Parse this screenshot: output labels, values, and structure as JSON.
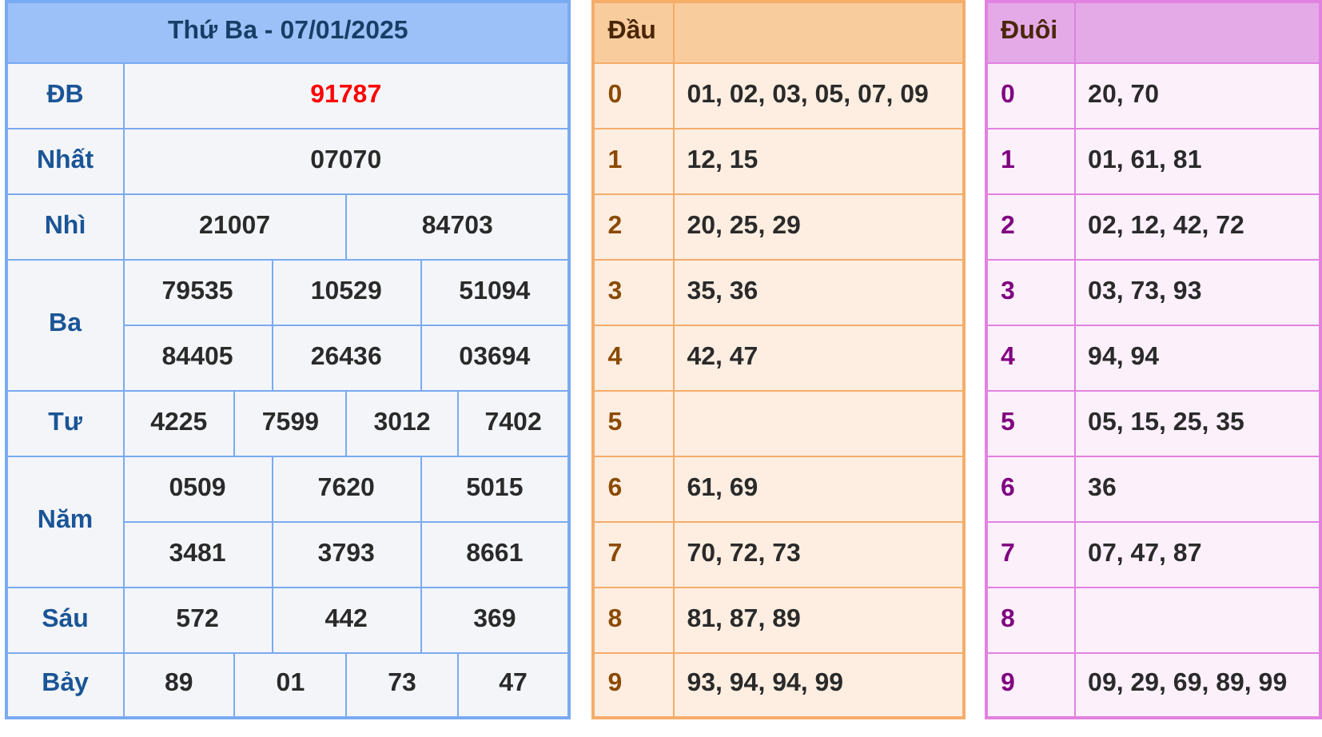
{
  "results": {
    "title": "Thứ Ba - 07/01/2025",
    "prizes": [
      {
        "name": "ĐB",
        "kind": "special",
        "lines": [
          [
            "91787"
          ]
        ]
      },
      {
        "name": "Nhất",
        "kind": "normal",
        "lines": [
          [
            "07070"
          ]
        ]
      },
      {
        "name": "Nhì",
        "kind": "normal",
        "lines": [
          [
            "21007",
            "84703"
          ]
        ]
      },
      {
        "name": "Ba",
        "kind": "normal",
        "lines": [
          [
            "79535",
            "10529",
            "51094"
          ],
          [
            "84405",
            "26436",
            "03694"
          ]
        ]
      },
      {
        "name": "Tư",
        "kind": "normal",
        "lines": [
          [
            "4225",
            "7599",
            "3012",
            "7402"
          ]
        ]
      },
      {
        "name": "Năm",
        "kind": "normal",
        "lines": [
          [
            "0509",
            "7620",
            "5015"
          ],
          [
            "3481",
            "3793",
            "8661"
          ]
        ]
      },
      {
        "name": "Sáu",
        "kind": "normal",
        "lines": [
          [
            "572",
            "442",
            "369"
          ]
        ]
      },
      {
        "name": "Bảy",
        "kind": "normal",
        "lines": [
          [
            "89",
            "01",
            "73",
            "47"
          ]
        ]
      }
    ]
  },
  "head_table": {
    "title": "Đầu",
    "rows": [
      {
        "digit": "0",
        "numbers": "01, 02, 03, 05, 07, 09"
      },
      {
        "digit": "1",
        "numbers": "12, 15"
      },
      {
        "digit": "2",
        "numbers": "20, 25, 29"
      },
      {
        "digit": "3",
        "numbers": "35, 36"
      },
      {
        "digit": "4",
        "numbers": "42, 47"
      },
      {
        "digit": "5",
        "numbers": ""
      },
      {
        "digit": "6",
        "numbers": "61, 69"
      },
      {
        "digit": "7",
        "numbers": "70, 72, 73"
      },
      {
        "digit": "8",
        "numbers": "81, 87, 89"
      },
      {
        "digit": "9",
        "numbers": "93, 94, 94, 99"
      }
    ]
  },
  "tail_table": {
    "title": "Đuôi",
    "rows": [
      {
        "digit": "0",
        "numbers": "20, 70"
      },
      {
        "digit": "1",
        "numbers": "01, 61, 81"
      },
      {
        "digit": "2",
        "numbers": "02, 12, 42, 72"
      },
      {
        "digit": "3",
        "numbers": "03, 73, 93"
      },
      {
        "digit": "4",
        "numbers": "94, 94"
      },
      {
        "digit": "5",
        "numbers": "05, 15, 25, 35"
      },
      {
        "digit": "6",
        "numbers": "36"
      },
      {
        "digit": "7",
        "numbers": "07, 47, 87"
      },
      {
        "digit": "8",
        "numbers": ""
      },
      {
        "digit": "9",
        "numbers": "09, 29, 69, 89, 99"
      }
    ]
  }
}
